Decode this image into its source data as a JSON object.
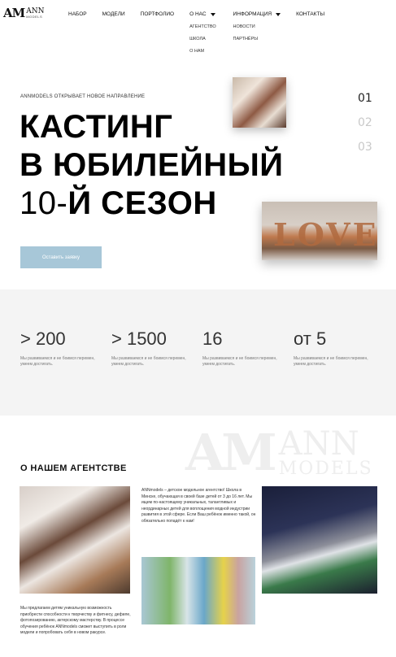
{
  "brand": {
    "mark": "AM",
    "name": "ANN",
    "sub": "MODELS"
  },
  "nav": {
    "items": [
      {
        "label": "НАБОР"
      },
      {
        "label": "МОДЕЛИ"
      },
      {
        "label": "ПОРТФОЛИО"
      },
      {
        "label": "О НАС",
        "submenu": [
          "АГЕНТСТВО",
          "ШКОЛА",
          "О НАМ"
        ]
      },
      {
        "label": "ИНФОРМАЦИЯ",
        "submenu": [
          "НОВОСТИ",
          "ПАРТНЁРЫ"
        ]
      },
      {
        "label": "КОНТАКТЫ"
      }
    ]
  },
  "hero": {
    "kicker": "ANNMODELS ОТКРЫВАЕТ НОВОЕ НАПРАВЛЕНИЕ",
    "line1": "КАСТИНГ",
    "line2": "В ЮБИЛЕЙНЫЙ",
    "line3_num": "10-",
    "line3_rest": "Й СЕЗОН",
    "cta": "Оставить заявку",
    "slides": [
      "01",
      "02",
      "03"
    ],
    "photo2_text": "LOVE"
  },
  "stats": [
    {
      "value": "> 200",
      "desc": "Мы развиваемся и не боимся перемен, умеем достигать."
    },
    {
      "value": "> 1500",
      "desc": "Мы развиваемся и не боимся перемен, умеем достигать."
    },
    {
      "value": "16",
      "desc": "Мы развиваемся и не боимся перемен, умеем достигать."
    },
    {
      "value": "от 5",
      "desc": "Мы развиваемся и не боимся перемен, умеем достигать."
    }
  ],
  "about": {
    "watermark_mark": "AM",
    "watermark_ann": "ANN",
    "watermark_models": "MODELS",
    "title": "О НАШЕМ АГЕНТСТВЕ",
    "text": "ANNmodels – детское модельное агентство! Школа в Минске, обучающая в своей базе детей от 3 до 16 лет. Мы ищем по-настоящему уникальных, талантливых и неординарных детей для воплощения модной индустрии развития в этой сфере. Если Ваш ребёнок именно такой, он обязательно попадёт к нам!",
    "text2": "Мы предлагаем детям уникальную возможность приобрести способности к творчеству и фитнесу, дефиле, фотопозированию, актерскому мастерству. В процессе обучения ребёнок ANNmodels сможет выступить в роли модели и попробовать себя в новом ракурсе."
  }
}
